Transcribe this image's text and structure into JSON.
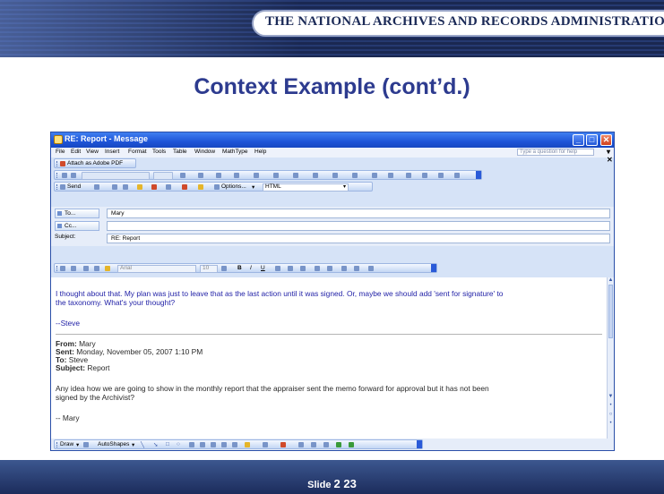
{
  "header": {
    "org_title": "THE NATIONAL ARCHIVES AND RECORDS ADMINISTRATION"
  },
  "slide": {
    "title": "Context Example (cont’d.)"
  },
  "window": {
    "title": "RE: Report - Message",
    "menu": [
      "File",
      "Edit",
      "View",
      "Insert",
      "Format",
      "Tools",
      "Table",
      "Window",
      "MathType",
      "Help"
    ],
    "help_placeholder": "Type a question for help",
    "attach_button": "Attach as Adobe PDF",
    "send_button": "Send",
    "options_button": "Options...",
    "format_select": "HTML",
    "font_select": "Arial",
    "size_select": "10"
  },
  "fields": {
    "to_button": "To...",
    "to_value": "Mary",
    "cc_button": "Cc...",
    "cc_value": "",
    "subject_label": "Subject:",
    "subject_value": "RE: Report"
  },
  "message": {
    "reply_line1": "I thought about that.  My plan was just to leave that as the last action until it was signed.  Or, maybe we should add 'sent for signature' to",
    "reply_line2": "the taxonomy.  What's your thought?",
    "signature": "--Steve",
    "from_label": "From:",
    "from_value": "Mary",
    "sent_label": "Sent:",
    "sent_value": "Monday, November 05, 2007 1:10 PM",
    "to_label": "To:",
    "to_value": "Steve",
    "subject_label": "Subject:",
    "subject_value": "Report",
    "orig_line1": "Any idea how we are going to show in the monthly report that the appraiser sent the memo forward for approval but it has not been",
    "orig_line2": "signed by the Archivist?",
    "orig_signature": "-- Mary"
  },
  "drawing": {
    "draw_menu": "Draw",
    "autoshapes_menu": "AutoShapes"
  },
  "footer": {
    "slide_label": "Slide",
    "slide_number": "2  23"
  }
}
